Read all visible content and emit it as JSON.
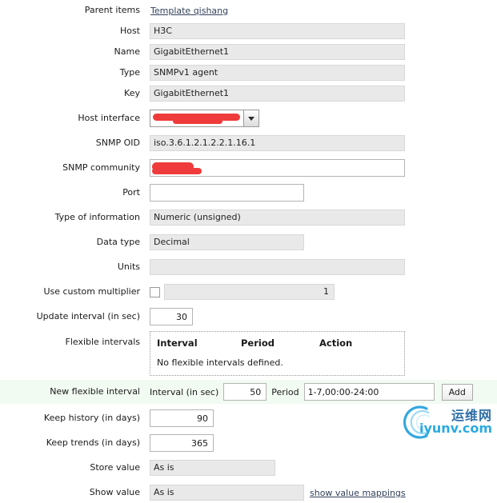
{
  "form": {
    "rows": [
      {
        "label": "Parent items",
        "value": "Template qishang",
        "kind": "link"
      },
      {
        "label": "Host",
        "value": "H3C",
        "kind": "readonly"
      },
      {
        "label": "Name",
        "value": "GigabitEthernet1",
        "kind": "readonly"
      },
      {
        "label": "Type",
        "value": "SNMPv1 agent",
        "kind": "readonly"
      },
      {
        "label": "Key",
        "value": "GigabitEthernet1",
        "kind": "readonly"
      },
      {
        "label": "Host interface",
        "value": "",
        "kind": "select-redacted"
      },
      {
        "label": "SNMP OID",
        "value": "iso.3.6.1.2.1.2.2.1.16.1",
        "kind": "readonly"
      },
      {
        "label": "SNMP community",
        "value": "",
        "kind": "input-redacted"
      },
      {
        "label": "Port",
        "value": "",
        "kind": "input"
      },
      {
        "label": "Type of information",
        "value": "Numeric (unsigned)",
        "kind": "readonly"
      },
      {
        "label": "Data type",
        "value": "Decimal",
        "kind": "readonly"
      },
      {
        "label": "Units",
        "value": "",
        "kind": "readonly"
      },
      {
        "label": "Use custom multiplier",
        "value": "1",
        "kind": "checkbox-value"
      },
      {
        "label": "Update interval (in sec)",
        "value": "30",
        "kind": "input-num"
      },
      {
        "label": "Flexible intervals",
        "value": "",
        "kind": "panel"
      },
      {
        "label": "New flexible interval",
        "value": "",
        "kind": "new-interval"
      },
      {
        "label": "Keep history (in days)",
        "value": "90",
        "kind": "input-days"
      },
      {
        "label": "Keep trends (in days)",
        "value": "365",
        "kind": "input-days"
      },
      {
        "label": "Store value",
        "value": "As is",
        "kind": "readonly-store"
      },
      {
        "label": "Show value",
        "value": "As is",
        "kind": "readonly-show"
      }
    ],
    "labels": {
      "parent_items": "Parent items",
      "host": "Host",
      "name": "Name",
      "type": "Type",
      "key": "Key",
      "host_interface": "Host interface",
      "snmp_oid": "SNMP OID",
      "snmp_community": "SNMP community",
      "port": "Port",
      "type_of_information": "Type of information",
      "data_type": "Data type",
      "units": "Units",
      "use_custom_multiplier": "Use custom multiplier",
      "update_interval": "Update interval (in sec)",
      "flexible_intervals": "Flexible intervals",
      "new_flexible_interval": "New flexible interval",
      "keep_history": "Keep history (in days)",
      "keep_trends": "Keep trends (in days)",
      "store_value": "Store value",
      "show_value": "Show value"
    },
    "values": {
      "parent_items_link": "Template qishang",
      "host": "H3C",
      "name": "GigabitEthernet1",
      "type": "SNMPv1 agent",
      "key": "GigabitEthernet1",
      "host_interface": "",
      "snmp_oid": "iso.3.6.1.2.1.2.2.1.16.1",
      "snmp_community": "",
      "port": "",
      "type_of_information": "Numeric (unsigned)",
      "data_type": "Decimal",
      "units": "",
      "custom_multiplier": "1",
      "update_interval": "30",
      "keep_history": "90",
      "keep_trends": "365",
      "store_value": "As is",
      "show_value": "As is"
    },
    "placeholders": {
      "port": "",
      "snmp_community": ""
    }
  },
  "flexible_intervals": {
    "columns": [
      "Interval",
      "Period",
      "Action"
    ],
    "empty_message": "No flexible intervals defined.",
    "new": {
      "interval_label": "Interval (in sec)",
      "interval_value": "50",
      "period_label": "Period",
      "period_value": "1-7,00:00-24:00",
      "add_label": "Add"
    }
  },
  "links": {
    "show_value_mappings": "show value mappings"
  },
  "watermark": {
    "cn": "运维网",
    "en": "iyunv.com"
  },
  "colors": {
    "redaction": "#ef3b3b",
    "highlight_row": "#f2fbf2",
    "link": "#31415a",
    "readonly_bg": "#e9e9e9",
    "watermark_cn": "#2e6fa8",
    "watermark_en": "#2aaae1"
  }
}
